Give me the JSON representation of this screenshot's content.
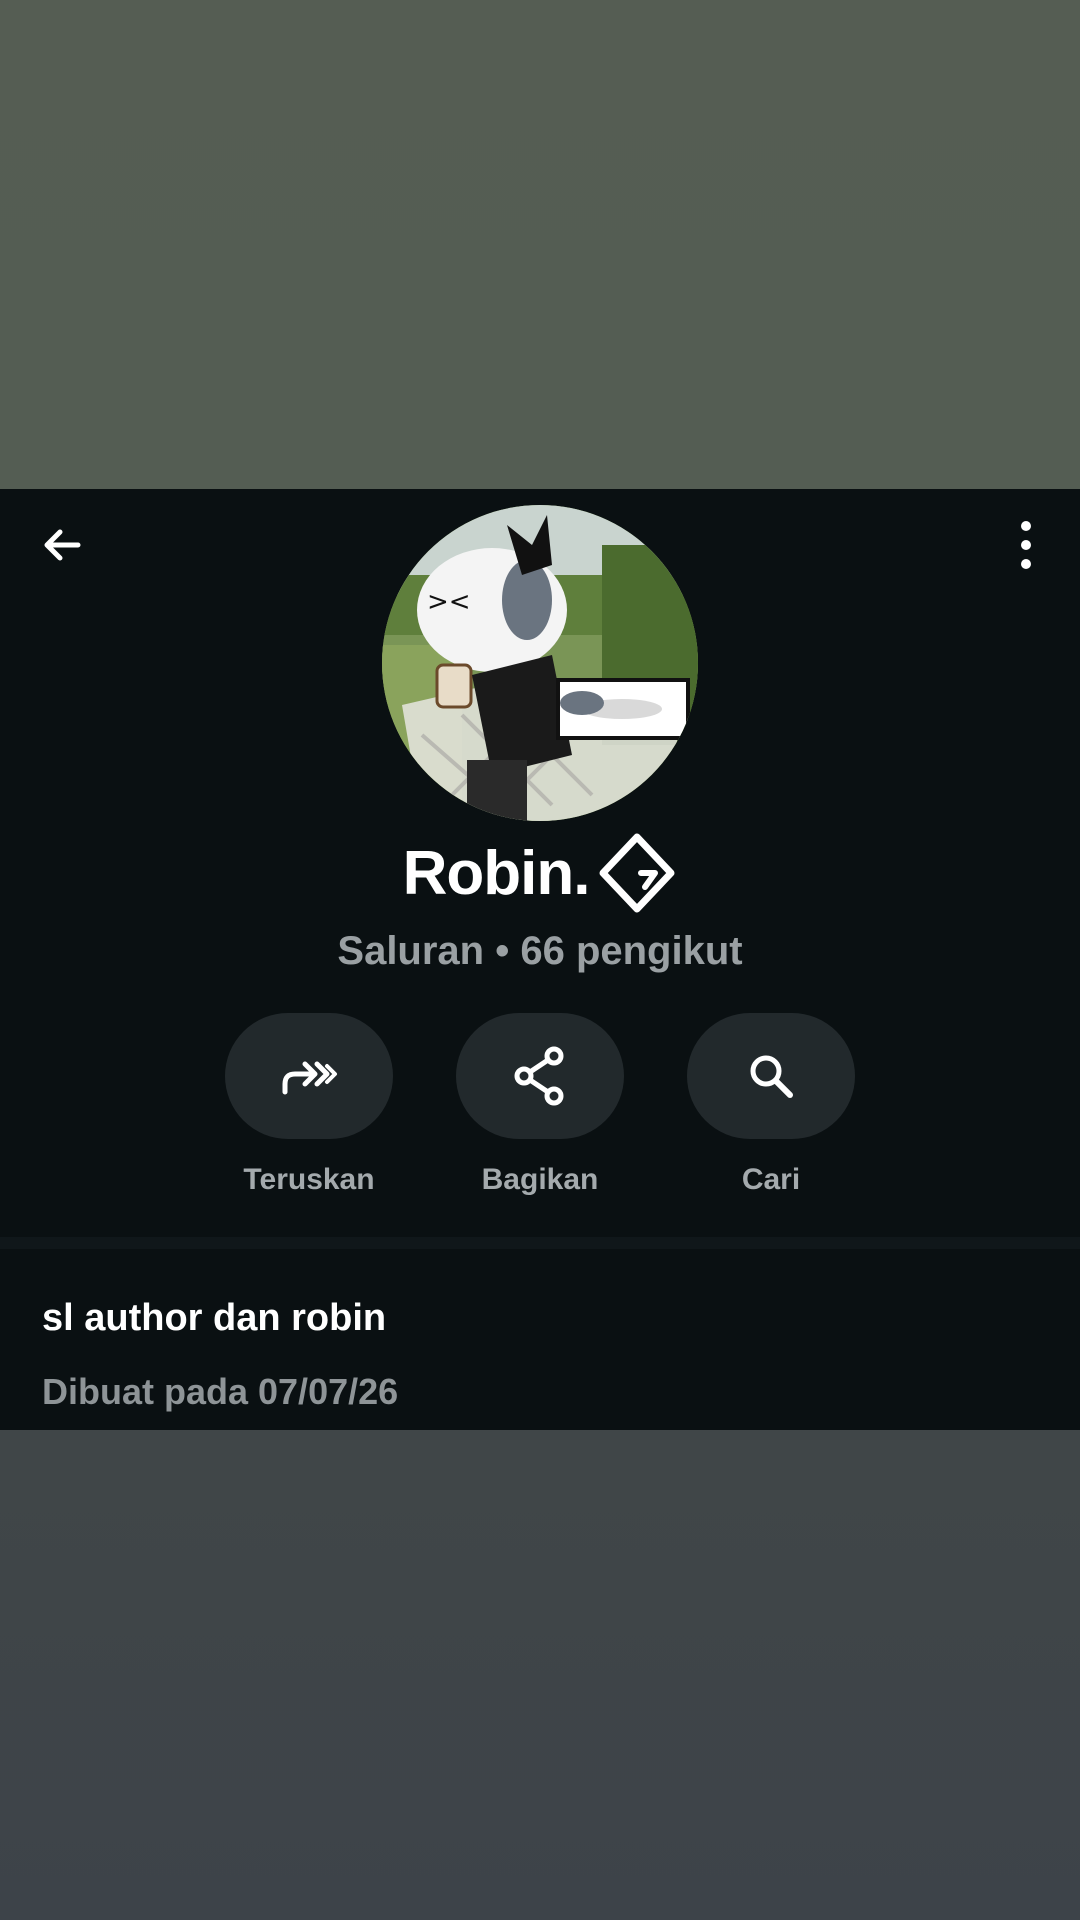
{
  "channel": {
    "name": "Robin.",
    "subtitle": "Saluran • 66 pengikut",
    "description": "sl author dan robin",
    "created": "Dibuat pada 07/07/26"
  },
  "actions": [
    {
      "label": "Teruskan",
      "icon": "forward-icon"
    },
    {
      "label": "Bagikan",
      "icon": "share-icon"
    },
    {
      "label": "Cari",
      "icon": "search-icon"
    }
  ],
  "icons": {
    "back": "arrow-left-icon",
    "menu": "more-vertical-icon",
    "verified": "channel-badge-icon"
  },
  "colors": {
    "panel": "#0a1012",
    "pill": "#22292c",
    "text": "#ffffff",
    "muted": "#9aa0a3"
  }
}
